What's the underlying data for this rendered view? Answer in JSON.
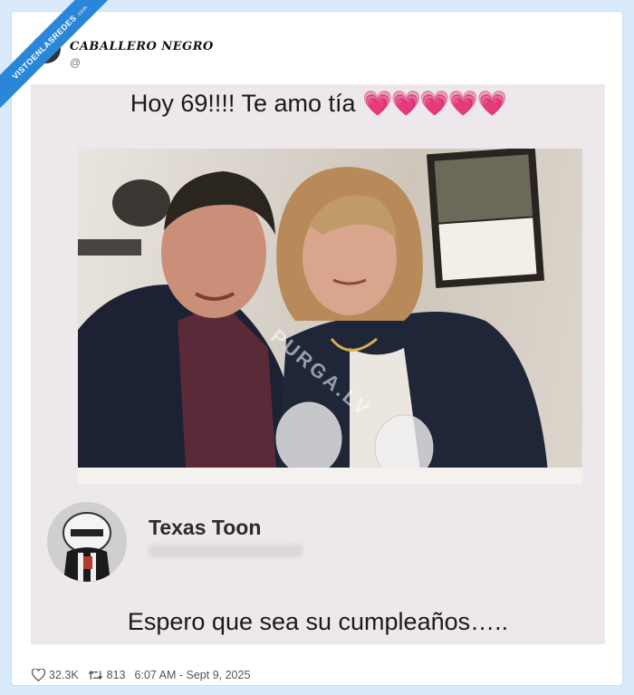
{
  "watermark_site": {
    "name": "VISTOENLASREDES",
    "suffix": ".com"
  },
  "post": {
    "author_name": "CABALLERO NEGRO",
    "author_handle": "@",
    "stats": {
      "likes": "32.3K",
      "retweets": "813",
      "timestamp": "6:07 AM - Sept 9, 2025"
    }
  },
  "meme": {
    "title": "Hoy 69!!!! Te amo tía",
    "hearts": "💗💗💗💗💗",
    "photo_watermark": "PURGA.LV",
    "reply_author": "Texas Toon",
    "reply_text": "Espero que sea su cumpleaños….."
  },
  "colors": {
    "background": "#d9ebfa",
    "ribbon": "#2a86d8",
    "hearts": "#ff3fa9",
    "meme_bg": "#ede8ec"
  },
  "icons": [
    "heart-icon",
    "retweet-icon"
  ]
}
